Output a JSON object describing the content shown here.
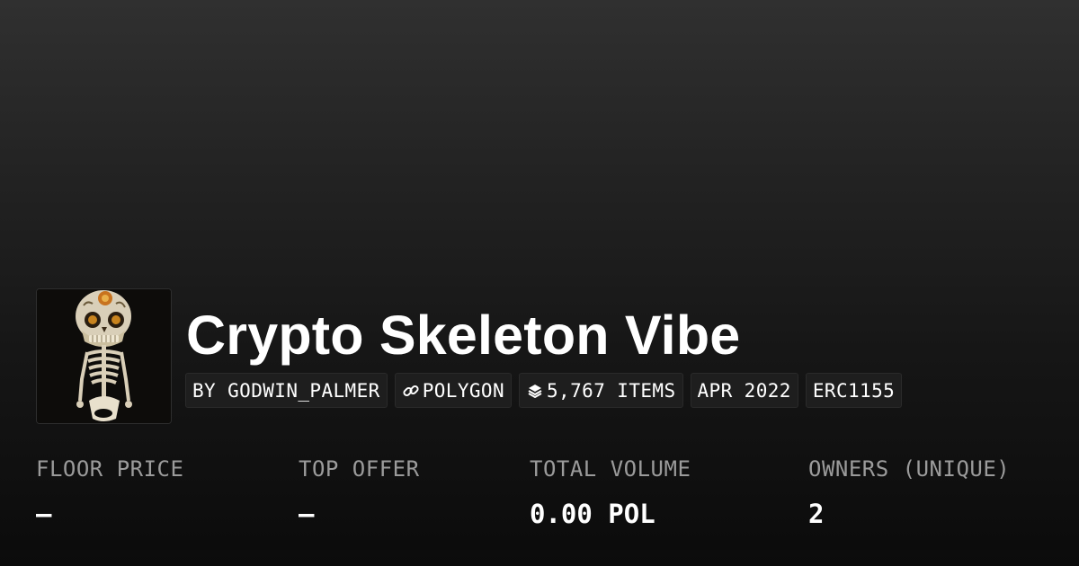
{
  "collection": {
    "title": "Crypto Skeleton Vibe",
    "creator": "BY GODWIN_PALMER",
    "chain": "POLYGON",
    "items": "5,767 ITEMS",
    "created": "APR 2022",
    "standard": "ERC1155",
    "thumbnail_icon": "skeleton-image"
  },
  "stats": [
    {
      "label": "FLOOR PRICE",
      "value": "–"
    },
    {
      "label": "TOP OFFER",
      "value": "–"
    },
    {
      "label": "TOTAL VOLUME",
      "value": "0.00 POL"
    },
    {
      "label": "OWNERS (UNIQUE)",
      "value": "2"
    }
  ],
  "icons": {
    "chain": "link-icon",
    "items": "layers-icon"
  },
  "colors": {
    "background_top": "#303030",
    "background_bottom": "#0b0b0b",
    "tag_bg": "#1e1e1e",
    "label": "#9b9b9b",
    "text": "#ffffff"
  }
}
